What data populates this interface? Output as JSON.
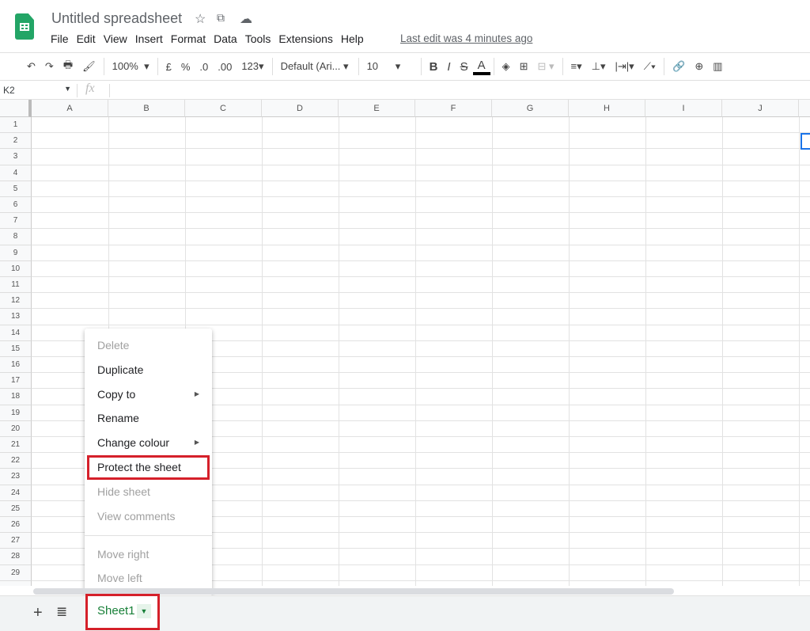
{
  "app": {
    "title": "Untitled spreadsheet",
    "icons": [
      "star-icon",
      "move-to-folder-icon",
      "cloud-saved-icon"
    ],
    "brand_color": "#23a566"
  },
  "menu": [
    "File",
    "Edit",
    "View",
    "Insert",
    "Format",
    "Data",
    "Tools",
    "Extensions",
    "Help"
  ],
  "last_edit": "Last edit was 4 minutes ago",
  "toolbar": {
    "zoom": "100%",
    "currency": "£",
    "percent": "%",
    "dec_decrease": ".0",
    "dec_increase": ".00",
    "format": "123",
    "font": "Default (Ari...",
    "font_size": "10",
    "bold": "B",
    "italic": "I",
    "strike": "S",
    "text_color": "A"
  },
  "formula_bar": {
    "name_box": "K2",
    "fx": "fx"
  },
  "columns": [
    "A",
    "B",
    "C",
    "D",
    "E",
    "F",
    "G",
    "H",
    "I",
    "J"
  ],
  "rows": [
    "1",
    "2",
    "3",
    "4",
    "5",
    "6",
    "7",
    "8",
    "9",
    "10",
    "11",
    "12",
    "13",
    "14",
    "15",
    "16",
    "17",
    "18",
    "19",
    "20",
    "21",
    "22",
    "23",
    "24",
    "25",
    "26",
    "27",
    "28",
    "29"
  ],
  "context_menu": [
    {
      "label": "Delete",
      "disabled": true
    },
    {
      "label": "Duplicate",
      "disabled": false
    },
    {
      "label": "Copy to",
      "disabled": false,
      "submenu": true
    },
    {
      "label": "Rename",
      "disabled": false
    },
    {
      "label": "Change colour",
      "disabled": false,
      "submenu": true
    },
    {
      "label": "Protect the sheet",
      "disabled": false,
      "highlighted": true
    },
    {
      "label": "Hide sheet",
      "disabled": true
    },
    {
      "label": "View comments",
      "disabled": true
    },
    {
      "label": "Move right",
      "disabled": true
    },
    {
      "label": "Move left",
      "disabled": true
    }
  ],
  "sheet_tab": {
    "label": "Sheet1",
    "color": "#188038"
  },
  "highlight_color": "#d5202a"
}
